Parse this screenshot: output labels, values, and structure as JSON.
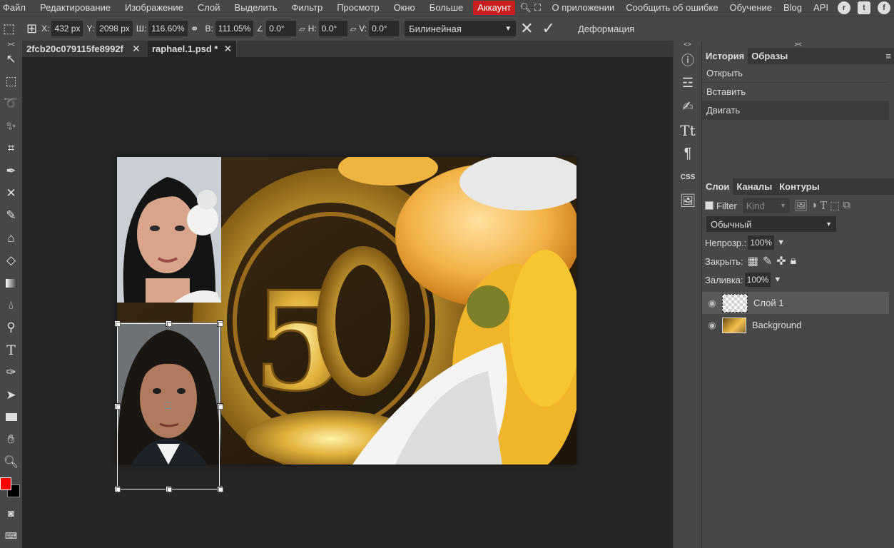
{
  "menu": {
    "items": [
      "Файл",
      "Редактирование",
      "Изображение",
      "Слой",
      "Выделить",
      "Фильтр",
      "Просмотр",
      "Окно",
      "Больше"
    ],
    "account": "Аккаунт",
    "right_items": [
      "О приложении",
      "Сообщить об ошибке",
      "Обучение",
      "Blog",
      "API"
    ],
    "social_icons": [
      "reddit-icon",
      "twitter-icon",
      "facebook-icon"
    ]
  },
  "options": {
    "x_label": "X:",
    "x_value": "432 px",
    "y_label": "Y:",
    "y_value": "2098 px",
    "w_label": "Ш:",
    "w_value": "116.60%",
    "h_label": "В:",
    "h_value": "111.05%",
    "angle_value": "0.0°",
    "skew_h_label": "H:",
    "skew_h_value": "0.0°",
    "skew_v_label": "V:",
    "skew_v_value": "0.0°",
    "interpolation": "Билинейная",
    "warp_label": "Деформация"
  },
  "tabs": [
    {
      "name": "2fcb20c079115fe8992f",
      "active": false
    },
    {
      "name": "raphael.1.psd *",
      "active": true
    }
  ],
  "history_panel": {
    "tabs": [
      "История",
      "Образы"
    ],
    "items": [
      "Открыть",
      "Вставить",
      "Двигать"
    ]
  },
  "layers_panel": {
    "tabs": [
      "Слои",
      "Каналы",
      "Контуры"
    ],
    "filter_label": "Filter",
    "kind_placeholder": "Kind",
    "blend_mode": "Обычный",
    "opacity_label": "Непрозр.:",
    "opacity_value": "100%",
    "lock_label": "Закрыть:",
    "fill_label": "Заливка:",
    "fill_value": "100%",
    "layers": [
      {
        "name": "Слой 1",
        "selected": true
      },
      {
        "name": "Background",
        "selected": false
      }
    ]
  },
  "colors": {
    "foreground": "#ff0000",
    "background": "#000000",
    "account_bg": "#c81e1e"
  }
}
